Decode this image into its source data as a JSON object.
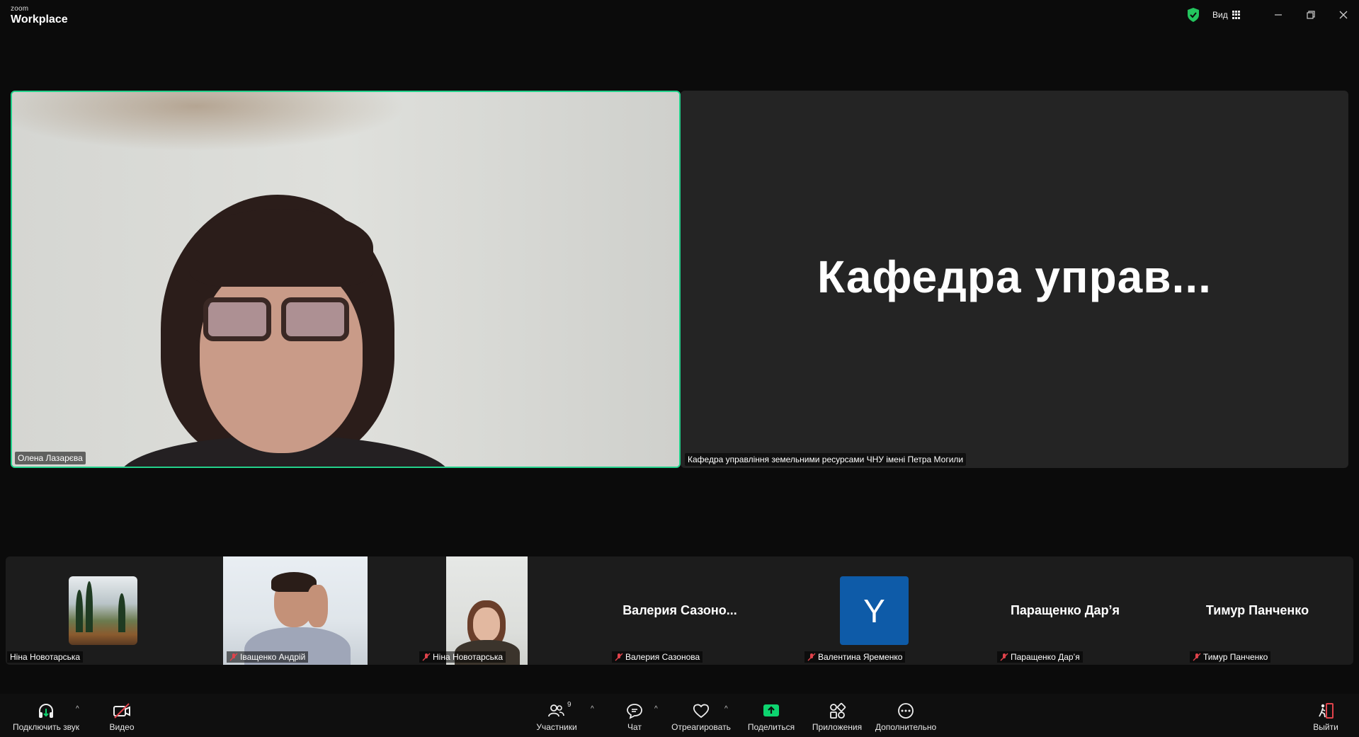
{
  "app": {
    "logo_top": "zoom",
    "logo_bottom": "Workplace"
  },
  "titlebar": {
    "view_label": "Вид",
    "minimize": "—",
    "maximize": "❐",
    "close": "✕"
  },
  "speaker": {
    "name": "Олена Лазарєва"
  },
  "presenter": {
    "display_title": "Кафедра  управ...",
    "name": "Кафедра управління земельними ресурсами ЧНУ імені Петра Могили"
  },
  "filmstrip": {
    "participants": [
      {
        "name": "Ніна Новотарська",
        "muted": false,
        "type": "image"
      },
      {
        "name": "Іващенко Андрій",
        "muted": true,
        "type": "video"
      },
      {
        "name": "Ніна Новотарська",
        "muted": true,
        "type": "video"
      },
      {
        "name": "Валерия Сазонова",
        "display": "Валерия  Сазоно...",
        "muted": true,
        "type": "name"
      },
      {
        "name": "Валентина Яременко",
        "initial": "Y",
        "muted": true,
        "type": "initial"
      },
      {
        "name": "Паращенко Дар’я",
        "display": "Паращенко Дар’я",
        "muted": true,
        "type": "name"
      },
      {
        "name": "Тимур Панченко",
        "display": "Тимур Панченко",
        "muted": true,
        "type": "name"
      }
    ]
  },
  "toolbar": {
    "audio": "Подключить звук",
    "video": "Видео",
    "participants": "Участники",
    "participants_count": "9",
    "chat": "Чат",
    "react": "Отреагировать",
    "share": "Поделиться",
    "apps": "Приложения",
    "more": "Дополнительно",
    "leave": "Выйти"
  },
  "colors": {
    "active_speaker": "#23d18b",
    "share_green": "#0dd46f",
    "leave_red": "#e0424b",
    "avatar_blue": "#0e5ba8"
  }
}
